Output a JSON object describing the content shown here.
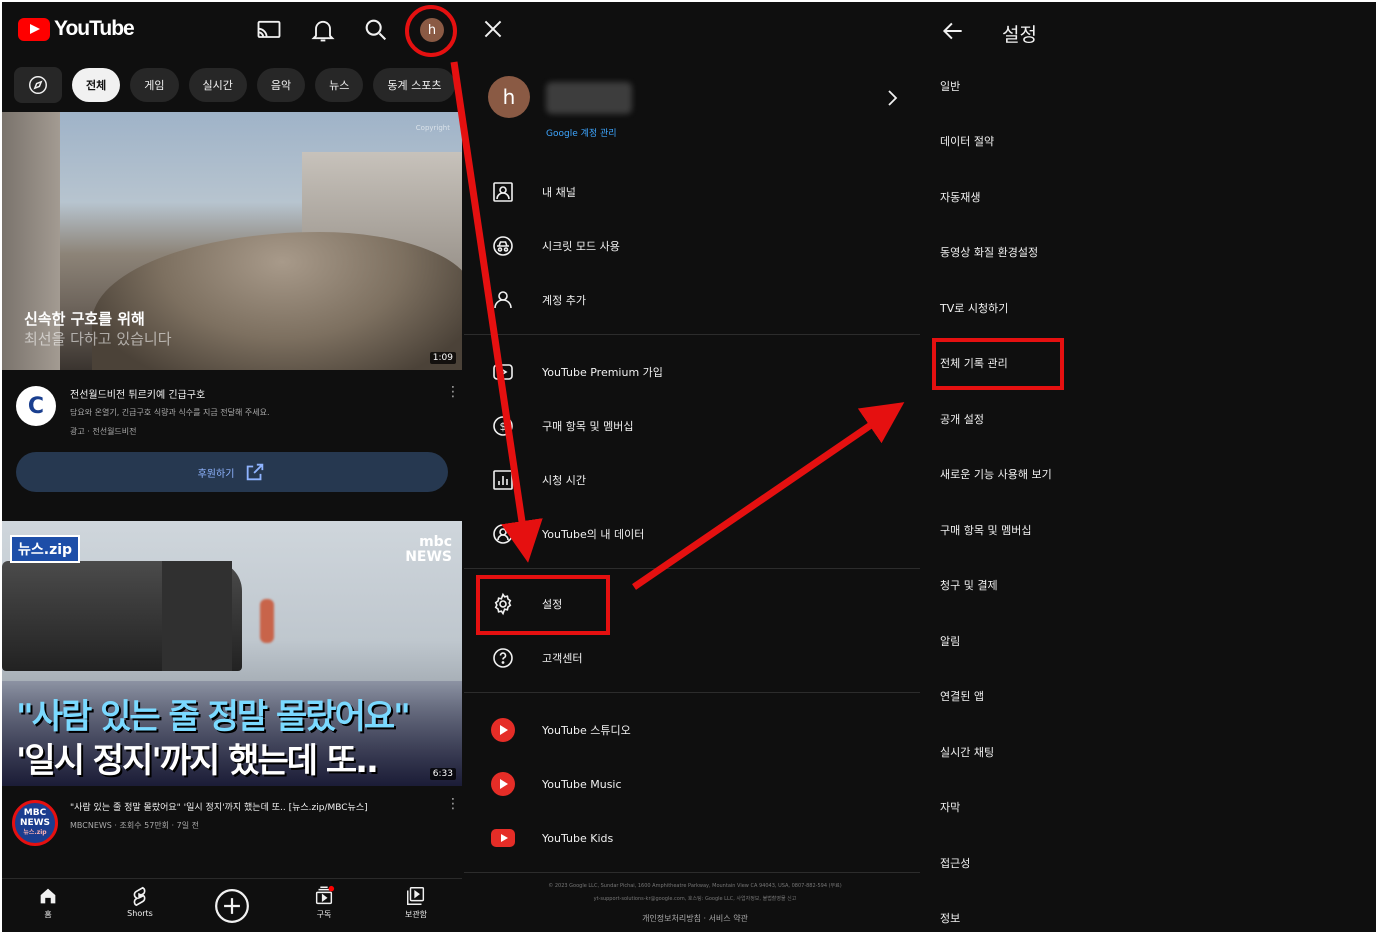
{
  "home": {
    "logo_text": "YouTube",
    "avatar_letter": "h",
    "chips": [
      "전체",
      "게임",
      "실시간",
      "음악",
      "뉴스",
      "동계 스포츠"
    ],
    "video1": {
      "caption_line1": "신속한 구호를 위해",
      "caption_line2": "최선을 다하고 있습니다",
      "duration": "1:09",
      "watermark": "Copyright"
    },
    "ad": {
      "logo_letter": "C",
      "title": "전선월드비전 튀르키예 긴급구호",
      "description": "담요와 온열기, 긴급구호 식량과 식수를 지금 전달해 주세요.",
      "meta": "광고 · 전선월드비전",
      "cta_label": "후원하기"
    },
    "video2": {
      "badge": "뉴스.zip",
      "brand_line1": "mbc",
      "brand_line2": "NEWS",
      "headline1": "\"사람 있는 줄 정말 몰랐어요\"",
      "headline2": "'일시 정지'까지 했는데 또..",
      "duration": "6:33",
      "channel_badge_line1": "MBC",
      "channel_badge_line2": "NEWS",
      "channel_badge_line3": "뉴스.zip",
      "title": "\"사람 있는 줄 정말 몰랐어요\" '일시 정지'까지 했는데 또.. [뉴스.zip/MBC뉴스]",
      "meta": "MBCNEWS · 조회수 57만회 · 7일 전"
    },
    "bottom_nav": [
      {
        "label": "홈"
      },
      {
        "label": "Shorts"
      },
      {
        "label": ""
      },
      {
        "label": "구독"
      },
      {
        "label": "보관함"
      }
    ]
  },
  "account_menu": {
    "avatar_letter": "h",
    "manage_account": "Google 계정 관리",
    "items": [
      {
        "label": "내 채널",
        "icon": "channel-icon"
      },
      {
        "label": "시크릿 모드 사용",
        "icon": "incognito-icon"
      },
      {
        "label": "계정 추가",
        "icon": "add-account-icon"
      },
      {
        "label": "YouTube Premium 가입",
        "icon": "premium-icon"
      },
      {
        "label": "구매 항목 및 멤버십",
        "icon": "purchases-icon"
      },
      {
        "label": "시청 시간",
        "icon": "time-watched-icon"
      },
      {
        "label": "YouTube의 내 데이터",
        "icon": "your-data-icon"
      },
      {
        "label": "설정",
        "icon": "gear-icon"
      },
      {
        "label": "고객센터",
        "icon": "help-icon"
      },
      {
        "label": "YouTube 스튜디오",
        "icon": "studio-icon"
      },
      {
        "label": "YouTube Music",
        "icon": "music-icon"
      },
      {
        "label": "YouTube Kids",
        "icon": "kids-icon"
      }
    ],
    "footer_line1": "© 2023 Google LLC, Sundar Pichai, 1600 Amphitheatre Parkway, Mountain View CA 94043, USA, 0807-882-594 (무료)",
    "footer_line2": "yt-support-solutions-kr@google.com, 호스팅: Google LLC, 사업자정보, 불법촬영물 신고",
    "footer_links": "개인정보처리방침 · 서비스 약관"
  },
  "settings": {
    "title": "설정",
    "items": [
      "일반",
      "데이터 절약",
      "자동재생",
      "동영상 화질 환경설정",
      "TV로 시청하기",
      "전체 기록 관리",
      "공개 설정",
      "새로운 기능 사용해 보기",
      "구매 항목 및 멤버십",
      "청구 및 결제",
      "알림",
      "연결된 앱",
      "실시간 채팅",
      "자막",
      "접근성",
      "정보"
    ]
  },
  "colors": {
    "background": "#0f0f0f",
    "highlight": "#e51010",
    "link_blue": "#3ea6ff",
    "youtube_red": "#ff0000"
  }
}
